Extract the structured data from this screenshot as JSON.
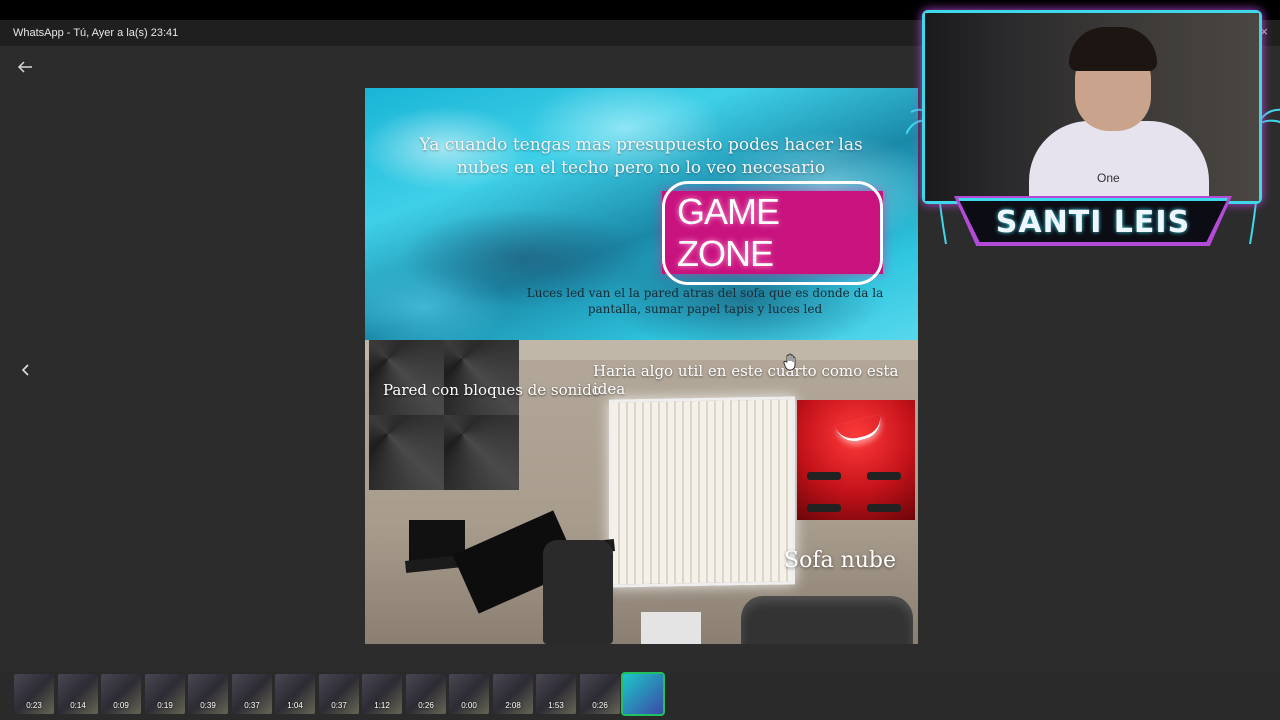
{
  "window": {
    "title": "WhatsApp - Tú, Ayer a la(s) 23:41",
    "close_glyph": "×"
  },
  "image": {
    "sky_caption": "Ya cuando tengas mas presupuesto podes hacer las nubes en el techo pero no lo veo necesario",
    "neon_sign": "GAME ZONE",
    "sky_note": "Luces led van el la pared atras del sofa que es donde da la pantalla, sumar papel tapis y luces led",
    "panel_label": "Pared con bloques de sonido",
    "room_caption": "Haria algo util en este cuarto como esta idea",
    "sofa_label": "Sofa nube"
  },
  "thumbnails": [
    {
      "duration": "0:23"
    },
    {
      "duration": "0:14"
    },
    {
      "duration": "0:09"
    },
    {
      "duration": "0:19"
    },
    {
      "duration": "0:39"
    },
    {
      "duration": "0:37"
    },
    {
      "duration": "1:04"
    },
    {
      "duration": "0:37"
    },
    {
      "duration": "1:12"
    },
    {
      "duration": "0:26"
    },
    {
      "duration": "0:00"
    },
    {
      "duration": "2:08"
    },
    {
      "duration": "1:53"
    },
    {
      "duration": "0:26"
    },
    {
      "duration": "",
      "selected": true
    }
  ],
  "webcam": {
    "name": "SANTI LEIS",
    "shirt_text": "One"
  },
  "icons": {
    "back": "arrow-left-icon",
    "prev": "chevron-left-icon",
    "more": "more-icon",
    "cursor": "hand-cursor-icon"
  },
  "colors": {
    "accent_green": "#21c063",
    "neon_cyan": "#3fd8ea",
    "neon_purple": "#b44bd8",
    "neon_pink": "#c8137e"
  }
}
